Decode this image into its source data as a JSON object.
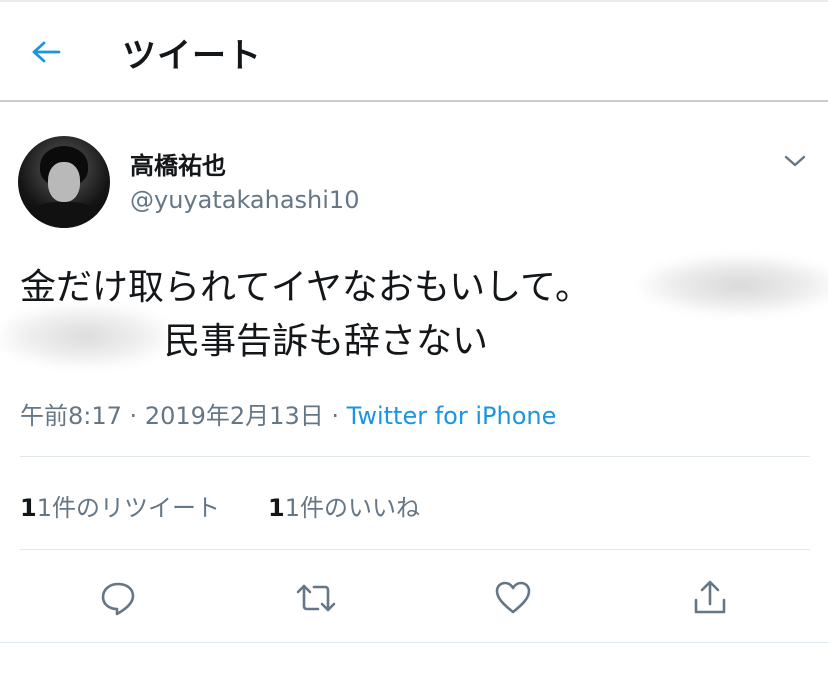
{
  "header": {
    "title": "ツイート",
    "back_icon": "arrow-left-icon"
  },
  "tweet": {
    "display_name": "高橋祐也",
    "screen_name": "@yuyatakahashi10",
    "text_line1": "金だけ取られてイヤなおもいして。",
    "text_line2": "民事告訴も辞さない",
    "time": "午前8:17",
    "dot": "·",
    "date": "2019年2月13日",
    "source": "Twitter for iPhone",
    "retweets_count": "1件の",
    "retweets_label": "リツイート",
    "likes_count": "1件の",
    "likes_label": "いいね"
  },
  "colors": {
    "accent": "#1b95e0",
    "secondary_text": "#657786",
    "primary_text": "#14171a"
  },
  "actions": [
    "reply-icon",
    "retweet-icon",
    "like-icon",
    "share-icon"
  ]
}
